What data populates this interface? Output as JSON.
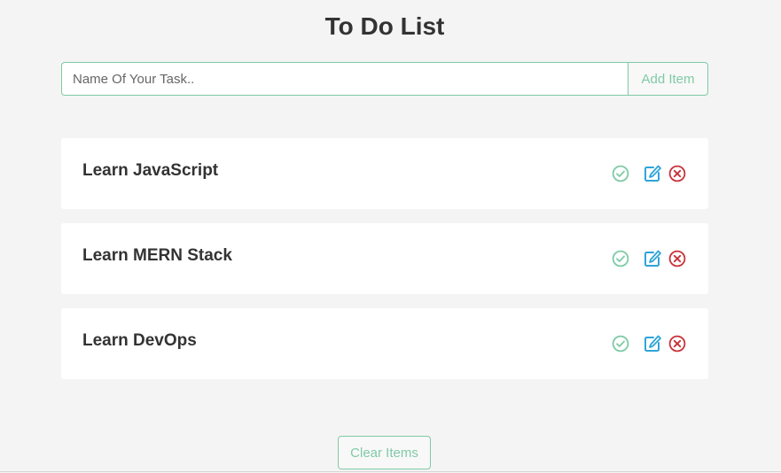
{
  "header": {
    "title": "To Do List"
  },
  "form": {
    "placeholder": "Name Of Your Task..",
    "value": "",
    "add_label": "Add Item"
  },
  "tasks": [
    {
      "name": "Learn JavaScript"
    },
    {
      "name": "Learn MERN Stack"
    },
    {
      "name": "Learn DevOps"
    }
  ],
  "icons": {
    "complete": "check-circle-icon",
    "edit": "edit-icon",
    "delete": "times-circle-icon"
  },
  "colors": {
    "accent": "#7fcaa6",
    "complete": "#7fcaa6",
    "edit": "#2fa4d9",
    "delete": "#c8333a",
    "background": "#f4f4f4"
  },
  "footer": {
    "clear_label": "Clear Items"
  }
}
